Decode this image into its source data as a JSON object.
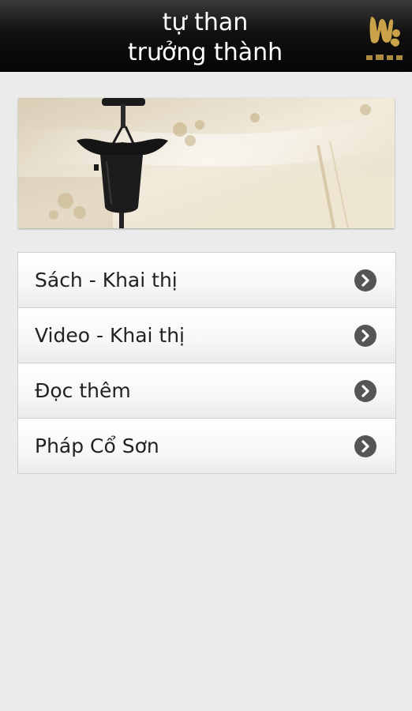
{
  "header": {
    "title_line1": "tự than",
    "title_line2": "trưởng thành",
    "logo_icon": "dharma-drum-logo-icon"
  },
  "banner": {
    "image": "temple-bell-ornament-photo"
  },
  "menu": {
    "items": [
      {
        "label": "Sách - Khai thị",
        "icon": "chevron-right-icon"
      },
      {
        "label": "Video - Khai thị",
        "icon": "chevron-right-icon"
      },
      {
        "label": "Đọc thêm",
        "icon": "chevron-right-icon"
      },
      {
        "label": "Pháp Cổ Sơn",
        "icon": "chevron-right-icon"
      }
    ]
  },
  "colors": {
    "header_bg": "#111111",
    "header_text": "#ffffff",
    "logo_gold": "#c9a24a",
    "page_bg": "#ebebeb",
    "chevron": "#555555"
  }
}
